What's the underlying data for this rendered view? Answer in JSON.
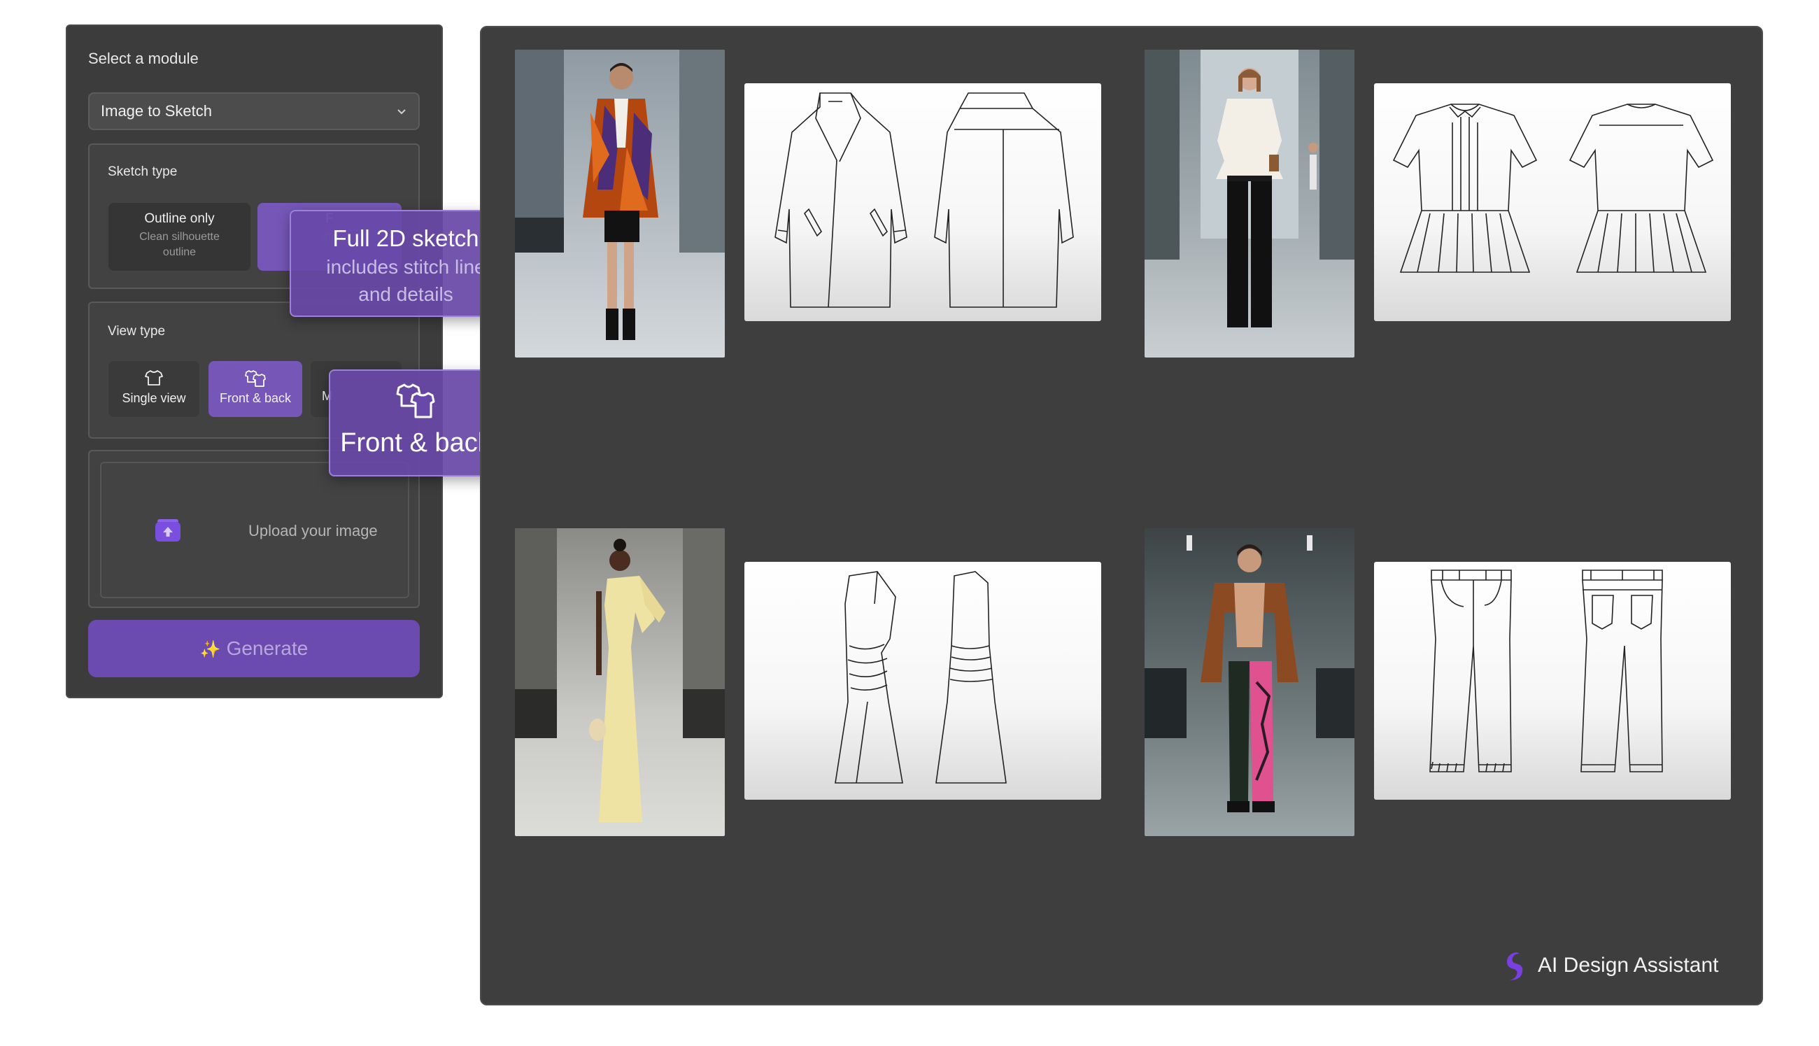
{
  "sidebar": {
    "title": "Select a module",
    "module_select": {
      "value": "Image to Sketch",
      "icon": "chevron-down-icon"
    },
    "sketch_type": {
      "label": "Sketch type",
      "options": [
        {
          "title": "Outline only",
          "desc_line1": "Clean silhouette",
          "desc_line2": "outline"
        },
        {
          "title": "F",
          "desc": "inc"
        }
      ]
    },
    "view_type": {
      "label": "View type",
      "options": [
        {
          "label": "Single view",
          "icon": "shirt-icon"
        },
        {
          "label": "Front & back",
          "icon": "front-back-shirt-icon"
        },
        {
          "label": "M"
        }
      ]
    },
    "upload": {
      "label": "Upload your image",
      "icon": "upload-icon"
    },
    "generate": {
      "label": "Generate",
      "icon": "sparkle-icon"
    }
  },
  "tooltips": {
    "sketch": {
      "title": "Full 2D sketch",
      "line1": "includes stitch line",
      "line2": "and details"
    },
    "view": {
      "title": "Front & back",
      "icon": "front-back-shirt-icon"
    }
  },
  "gallery": {
    "items": [
      {
        "photo": "runway model wearing orange and purple patterned coat",
        "sketch": "coat front and back technical sketch"
      },
      {
        "photo": "runway model wearing white peplum blouse and black trousers",
        "sketch": "peplum blouse front and back technical sketch"
      },
      {
        "photo": "runway model wearing yellow one-shoulder gown",
        "sketch": "one-shoulder gown front and back technical sketch"
      },
      {
        "photo": "runway model wearing brown fur jacket and pink trousers",
        "sketch": "trousers front and back technical sketch"
      }
    ],
    "brand": "AI Design Assistant"
  },
  "colors": {
    "accent": "#7657b8",
    "panel": "#3c3c3c",
    "gallery": "#3e3e3e"
  }
}
